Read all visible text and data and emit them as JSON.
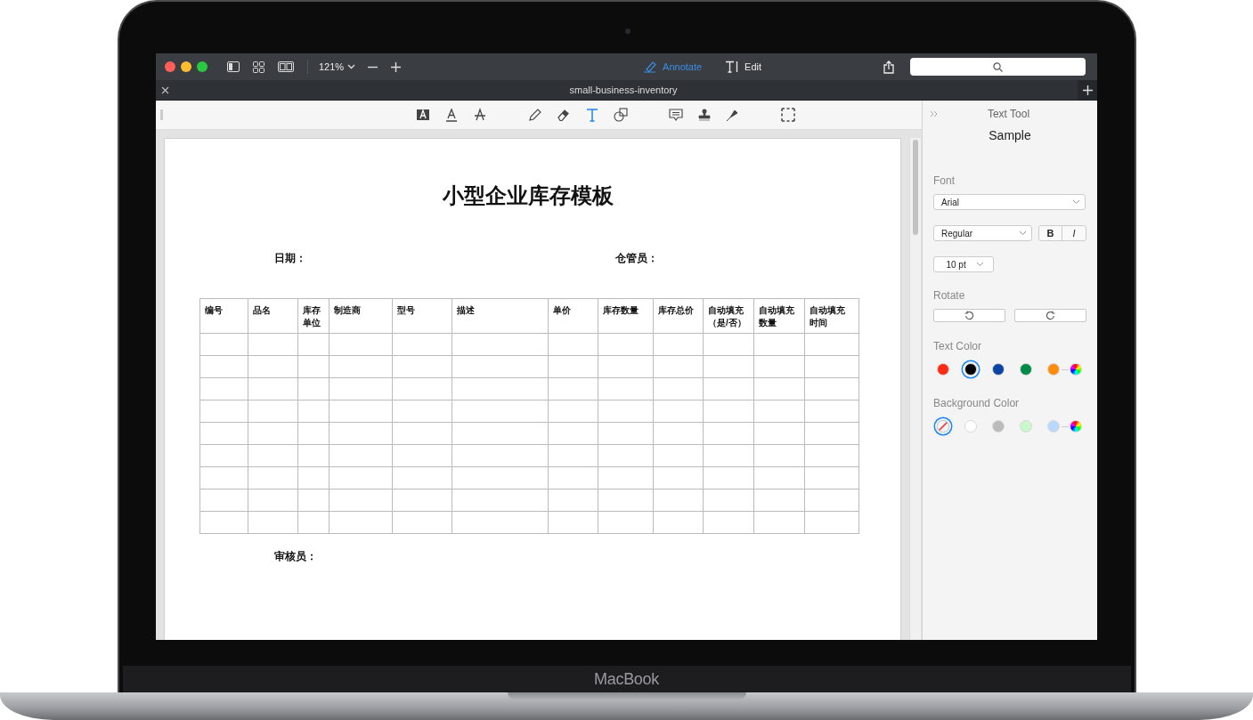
{
  "toolbar": {
    "zoom": "121%",
    "modes": [
      {
        "kind": "annotate",
        "label": "Annotate",
        "selected": true
      },
      {
        "kind": "edit",
        "label": "Edit",
        "selected": false
      }
    ]
  },
  "tab": {
    "title": "small-business-inventory"
  },
  "annotation_tool_groups": [
    [
      {
        "kind": "text-box",
        "selected": false
      },
      {
        "kind": "underline",
        "selected": false
      },
      {
        "kind": "strikethrough",
        "selected": false
      }
    ],
    [
      {
        "kind": "pencil",
        "selected": false
      },
      {
        "kind": "eraser",
        "selected": false
      },
      {
        "kind": "text",
        "selected": true
      },
      {
        "kind": "shape",
        "selected": false
      }
    ],
    [
      {
        "kind": "comment",
        "selected": false
      },
      {
        "kind": "stamp",
        "selected": false
      },
      {
        "kind": "signature",
        "selected": false
      }
    ],
    [
      {
        "kind": "selection",
        "selected": false
      }
    ]
  ],
  "document": {
    "title": "小型企业库存模板",
    "fields": [
      "日期：",
      "仓管员："
    ],
    "columns": [
      "编号",
      "品名",
      "库存单位",
      "制造商",
      "型号",
      "描述",
      "单价",
      "库存数量",
      "库存总价",
      "自动填充（是/否）",
      "自动填充数量",
      "自动填充时间"
    ],
    "footer_field": "审核员："
  },
  "panel": {
    "title": "Text Tool",
    "sample": "Sample",
    "font_label": "Font",
    "font": "Arial",
    "style": "Regular",
    "bold_label": "B",
    "italic_label": "I",
    "bold": false,
    "italic": false,
    "size": "10 pt",
    "rotate_label": "Rotate",
    "text_color_label": "Text Color",
    "text_colors": [
      {
        "kind": "swatch",
        "color": "#ff2a12",
        "selected": false
      },
      {
        "kind": "swatch",
        "color": "#000000",
        "selected": true
      },
      {
        "kind": "swatch",
        "color": "#0b45a3",
        "selected": false
      },
      {
        "kind": "swatch",
        "color": "#008a47",
        "selected": false
      },
      {
        "kind": "swatch",
        "color": "#ff8c0a",
        "selected": false
      },
      {
        "kind": "picker",
        "selected": false
      }
    ],
    "background_color_label": "Background Color",
    "background_colors": [
      {
        "kind": "none",
        "selected": true
      },
      {
        "kind": "swatch",
        "color": "#ffffff",
        "selected": false
      },
      {
        "kind": "swatch",
        "color": "#bbbbbb",
        "selected": false
      },
      {
        "kind": "swatch",
        "color": "#c9f8ca",
        "selected": false
      },
      {
        "kind": "swatch",
        "color": "#b9d9fc",
        "selected": false
      },
      {
        "kind": "picker",
        "selected": false
      }
    ]
  },
  "laptop": {
    "brand": "MacBook"
  }
}
